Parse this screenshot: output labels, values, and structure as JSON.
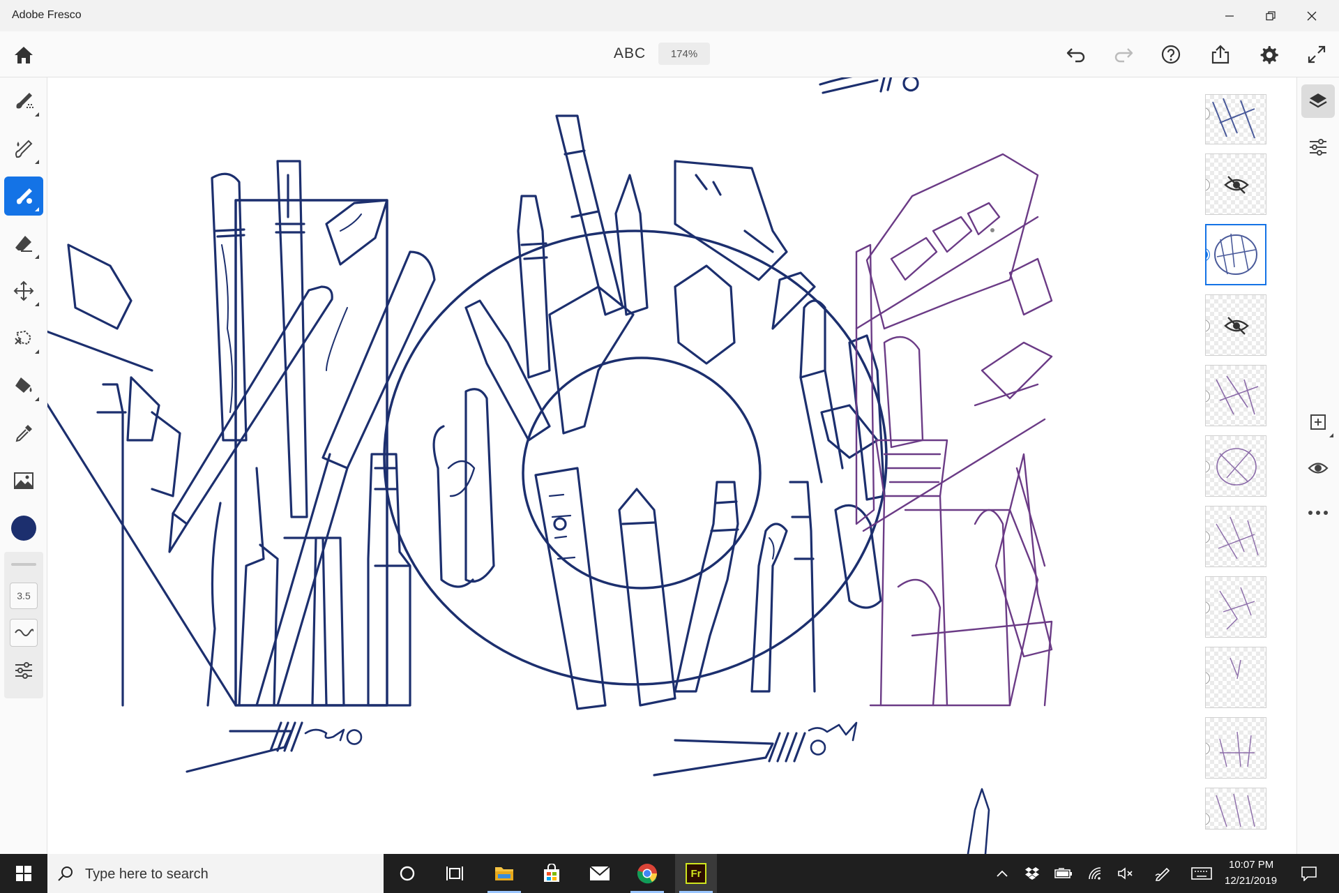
{
  "window": {
    "title": "Adobe Fresco"
  },
  "toolbar": {
    "document_title": "ABC",
    "zoom": "174%",
    "icons": [
      "home-icon",
      "undo-icon",
      "redo-icon",
      "help-icon",
      "share-icon",
      "settings-icon",
      "fullscreen-icon"
    ]
  },
  "left_tools": {
    "items": [
      "pixel-brush",
      "live-brush",
      "vector-brush",
      "eraser",
      "move-transform",
      "selection-lasso",
      "fill",
      "eyedropper",
      "place-image",
      "color"
    ],
    "active": "vector-brush",
    "brush_color": "#1c2f6e",
    "brush_size": "3.5"
  },
  "layers_panel": {
    "layer_count": 11,
    "selected_index": 2,
    "hidden_indices": [
      1,
      3
    ]
  },
  "right_rail": {
    "icons": [
      "layers-icon",
      "layer-properties-icon",
      "add-layer-icon",
      "visibility-icon",
      "more-icon"
    ]
  },
  "taskbar": {
    "search_placeholder": "Type here to search",
    "time": "10:07 PM",
    "date": "12/21/2019",
    "apps": [
      "cortana",
      "task-view",
      "file-explorer",
      "microsoft-store",
      "mail",
      "chrome",
      "adobe-fresco"
    ],
    "fresco_label": "Fr"
  },
  "colors": {
    "accent": "#1473e6",
    "ink": "#1c2f6e",
    "sketch": "#6b3b86"
  }
}
